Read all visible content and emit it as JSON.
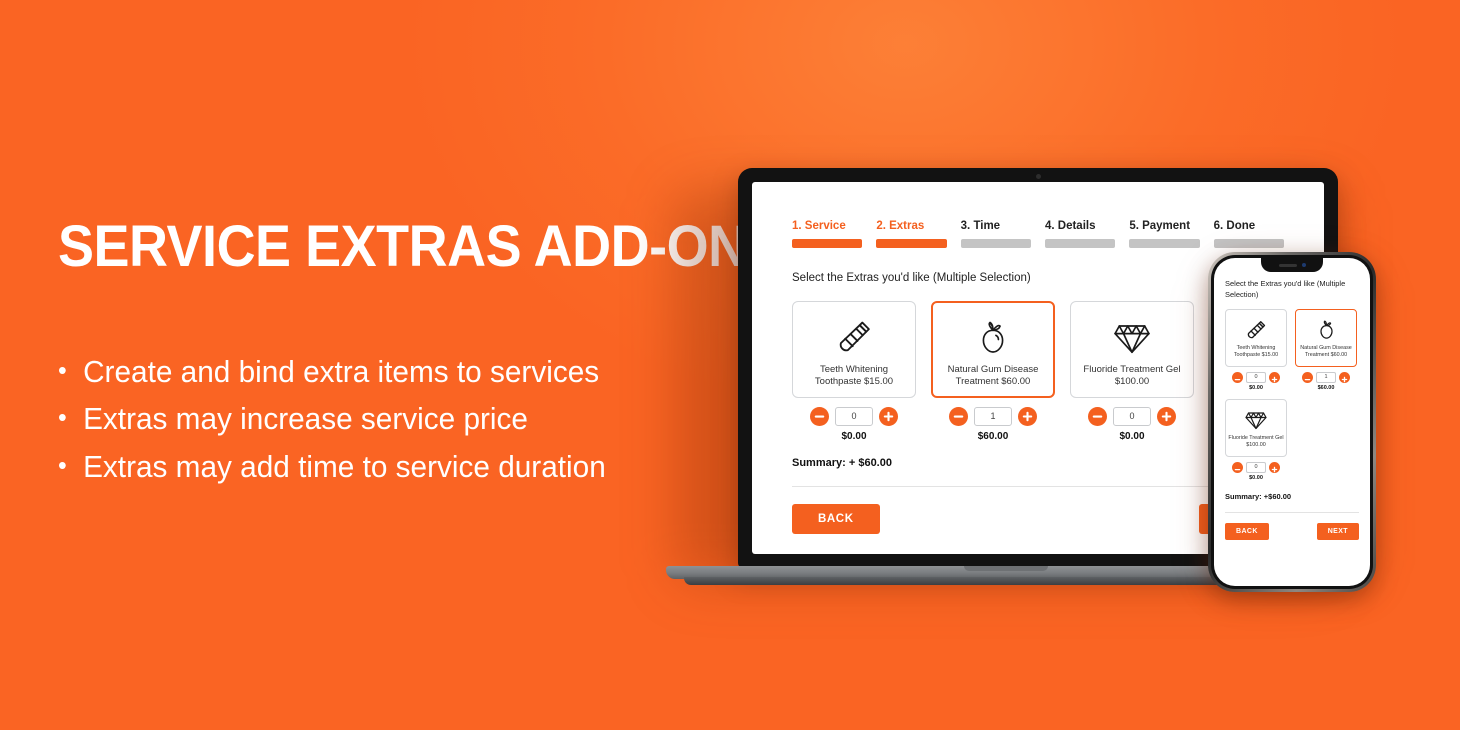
{
  "theme": {
    "brand_orange": "#fa6423",
    "accent": "#f4601f",
    "inactive_grey": "#c4c4c4"
  },
  "left": {
    "headline": "SERVICE EXTRAS ADD-ON",
    "bullet_marker": "•",
    "bullets": [
      "Create and bind extra items to services",
      "Extras may increase service price",
      "Extras may add time to service duration"
    ]
  },
  "app": {
    "steps": [
      {
        "label": "1. Service",
        "active": true
      },
      {
        "label": "2. Extras",
        "active": true
      },
      {
        "label": "3. Time",
        "active": false
      },
      {
        "label": "4. Details",
        "active": false
      },
      {
        "label": "5. Payment",
        "active": false
      },
      {
        "label": "6. Done",
        "active": false
      }
    ],
    "prompt": "Select the Extras you'd like (Multiple Selection)",
    "phone_prompt": "Select the Extras you'd like (Multiple Selection)",
    "extras": [
      {
        "icon": "toothpaste-tube-icon",
        "title": "Teeth Whitening Toothpaste $15.00",
        "phone_title": "Teeth Whitening Toothpaste $15.00",
        "quantity": "0",
        "line_total": "$0.00",
        "selected": false
      },
      {
        "icon": "apple-icon",
        "title": "Natural Gum Disease Treatment $60.00",
        "phone_title": "Natural Gum Disease Treatment $60.00",
        "quantity": "1",
        "line_total": "$60.00",
        "selected": true
      },
      {
        "icon": "diamond-icon",
        "title": "Fluoride Treatment Gel $100.00",
        "phone_title": "Fluoride Treatment Gel $100.00",
        "quantity": "0",
        "line_total": "$0.00",
        "selected": false
      }
    ],
    "summary": "Summary: + $60.00",
    "phone_summary": "Summary: +$60.00",
    "back_label": "BACK",
    "next_label": "NEXT",
    "phone_back_label": "BACK",
    "phone_next_label": "NEXT"
  }
}
